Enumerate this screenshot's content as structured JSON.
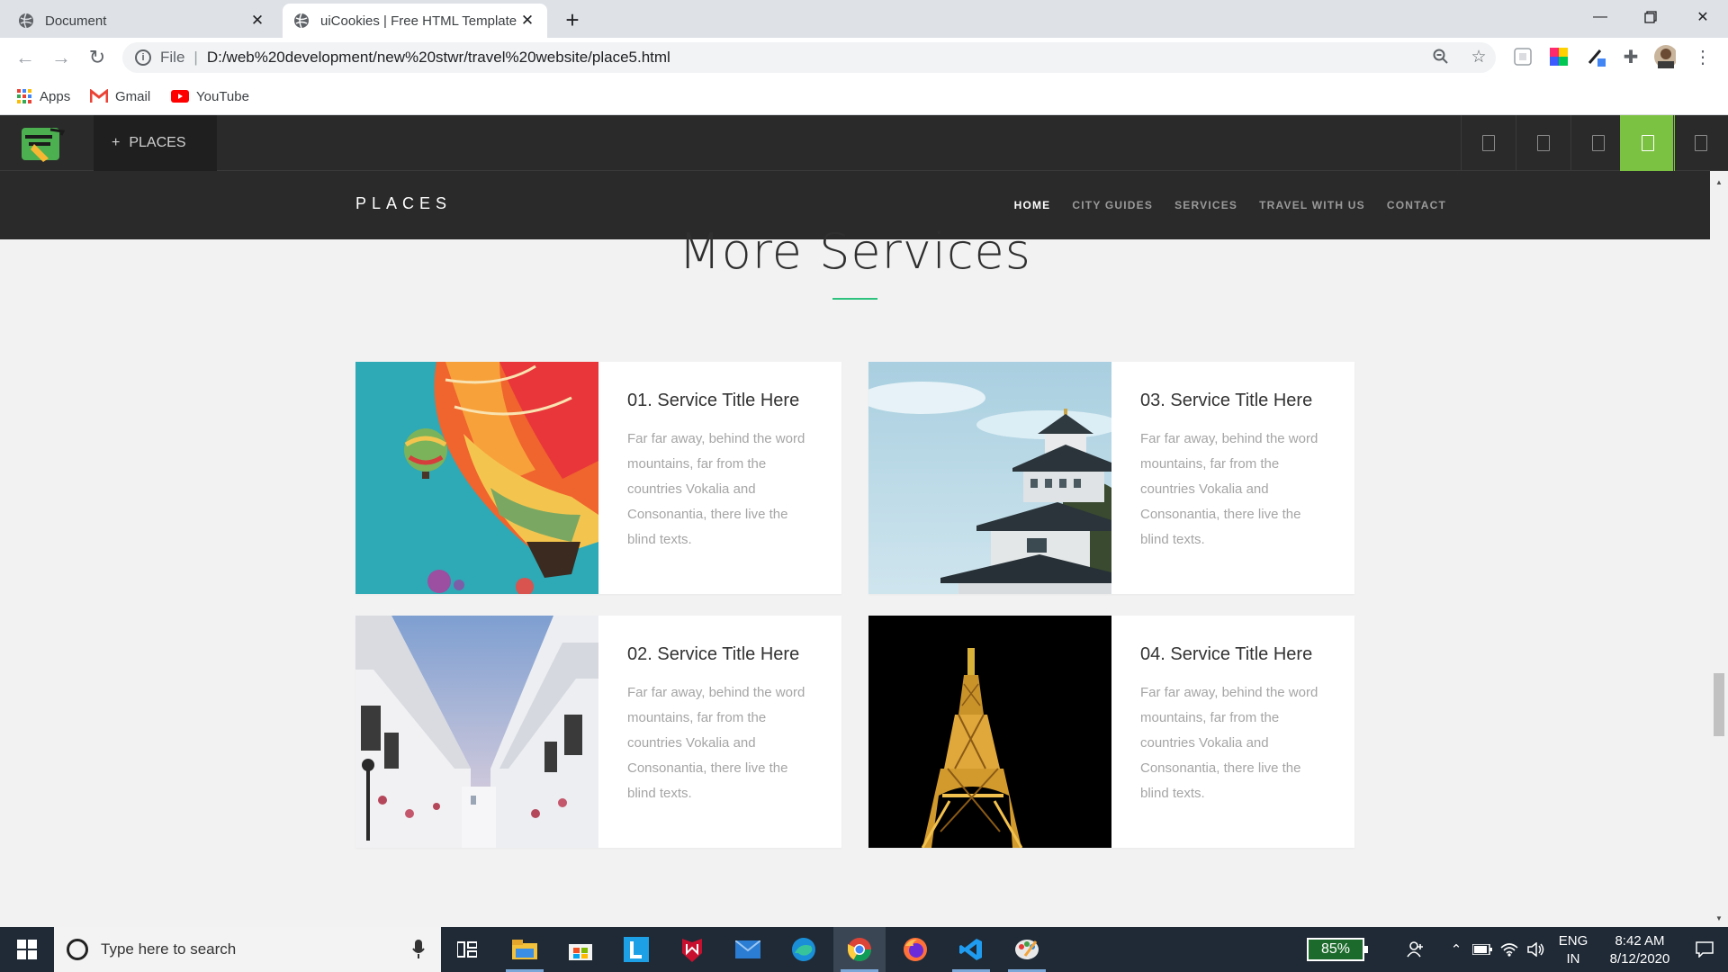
{
  "browser": {
    "tabs": [
      {
        "title": "Document",
        "active": false
      },
      {
        "title": "uiCookies | Free HTML Template",
        "active": true
      }
    ],
    "address": {
      "scheme": "File",
      "url": "D:/web%20development/new%20stwr/travel%20website/place5.html"
    },
    "bookmarks": [
      "Apps",
      "Gmail",
      "YouTube"
    ]
  },
  "preview_bar": {
    "places_label": "PLACES",
    "devices": [
      "device-1",
      "device-2",
      "device-3",
      "device-4",
      "device-5"
    ],
    "active_device_index": 3,
    "accent": "#7cc242"
  },
  "site": {
    "brand": "PLACES",
    "menu": [
      {
        "label": "HOME",
        "active": true
      },
      {
        "label": "CITY GUIDES",
        "active": false
      },
      {
        "label": "SERVICES",
        "active": false
      },
      {
        "label": "TRAVEL WITH US",
        "active": false
      },
      {
        "label": "CONTACT",
        "active": false
      }
    ],
    "section_title": "More Services",
    "accent": "#2ec27e",
    "services": [
      {
        "title": "01. Service Title Here",
        "desc": "Far far away, behind the word mountains, far from the countries Vokalia and Consonantia, there live the blind texts.",
        "image": "hot-air-balloon-photo"
      },
      {
        "title": "03. Service Title Here",
        "desc": "Far far away, behind the word mountains, far from the countries Vokalia and Consonantia, there live the blind texts.",
        "image": "japanese-castle-photo"
      },
      {
        "title": "02. Service Title Here",
        "desc": "Far far away, behind the word mountains, far from the countries Vokalia and Consonantia, there live the blind texts.",
        "image": "white-street-photo"
      },
      {
        "title": "04. Service Title Here",
        "desc": "Far far away, behind the word mountains, far from the countries Vokalia and Consonantia, there live the blind texts.",
        "image": "eiffel-tower-night-photo"
      }
    ]
  },
  "taskbar": {
    "search_placeholder": "Type here to search",
    "battery": "85%",
    "language": "ENG",
    "region": "IN",
    "time": "8:42 AM",
    "date": "8/12/2020"
  }
}
